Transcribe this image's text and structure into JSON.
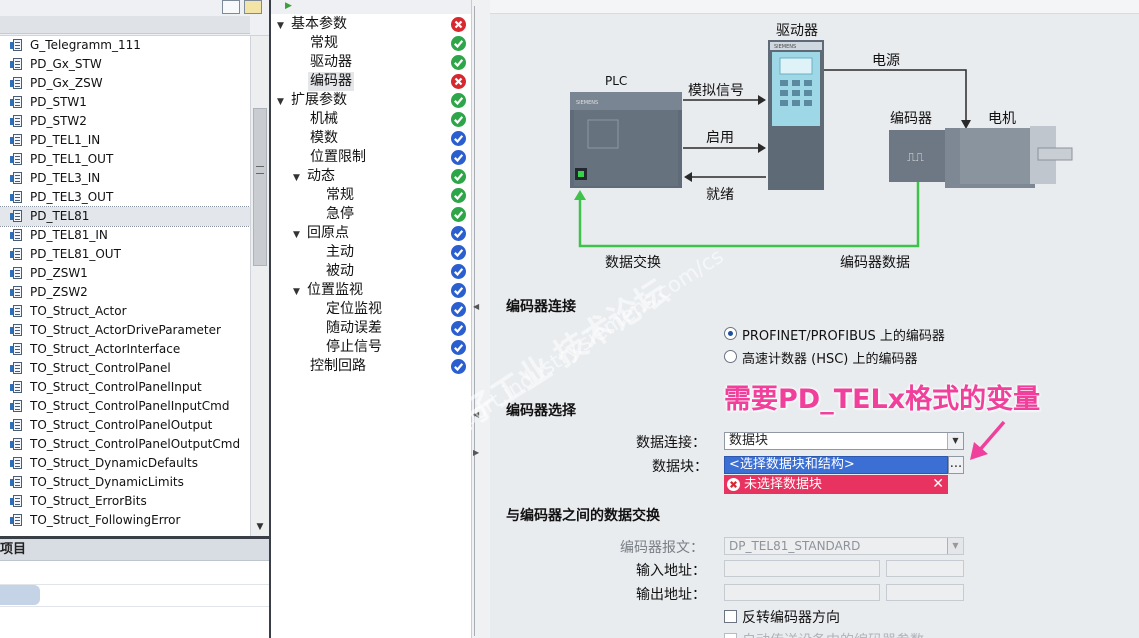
{
  "tag_list": {
    "items": [
      {
        "label": "G_Telegramm_111",
        "selected": false
      },
      {
        "label": "PD_Gx_STW",
        "selected": false
      },
      {
        "label": "PD_Gx_ZSW",
        "selected": false
      },
      {
        "label": "PD_STW1",
        "selected": false
      },
      {
        "label": "PD_STW2",
        "selected": false
      },
      {
        "label": "PD_TEL1_IN",
        "selected": false
      },
      {
        "label": "PD_TEL1_OUT",
        "selected": false
      },
      {
        "label": "PD_TEL3_IN",
        "selected": false
      },
      {
        "label": "PD_TEL3_OUT",
        "selected": false
      },
      {
        "label": "PD_TEL81",
        "selected": true
      },
      {
        "label": "PD_TEL81_IN",
        "selected": false
      },
      {
        "label": "PD_TEL81_OUT",
        "selected": false
      },
      {
        "label": "PD_ZSW1",
        "selected": false
      },
      {
        "label": "PD_ZSW2",
        "selected": false
      },
      {
        "label": "TO_Struct_Actor",
        "selected": false
      },
      {
        "label": "TO_Struct_ActorDriveParameter",
        "selected": false
      },
      {
        "label": "TO_Struct_ActorInterface",
        "selected": false
      },
      {
        "label": "TO_Struct_ControlPanel",
        "selected": false
      },
      {
        "label": "TO_Struct_ControlPanelInput",
        "selected": false
      },
      {
        "label": "TO_Struct_ControlPanelInputCmd",
        "selected": false
      },
      {
        "label": "TO_Struct_ControlPanelOutput",
        "selected": false
      },
      {
        "label": "TO_Struct_ControlPanelOutputCmd",
        "selected": false
      },
      {
        "label": "TO_Struct_DynamicDefaults",
        "selected": false
      },
      {
        "label": "TO_Struct_DynamicLimits",
        "selected": false
      },
      {
        "label": "TO_Struct_ErrorBits",
        "selected": false
      },
      {
        "label": "TO_Struct_FollowingError",
        "selected": false
      }
    ]
  },
  "details_panel": {
    "title": "项目"
  },
  "config_tree": {
    "items": [
      {
        "label": "基本参数",
        "indent": 0,
        "toggle": "▼",
        "status": "error",
        "selected": false
      },
      {
        "label": "常规",
        "indent": 1,
        "toggle": "",
        "status": "ok",
        "selected": false
      },
      {
        "label": "驱动器",
        "indent": 1,
        "toggle": "",
        "status": "ok",
        "selected": false
      },
      {
        "label": "编码器",
        "indent": 1,
        "toggle": "",
        "status": "error",
        "selected": true
      },
      {
        "label": "扩展参数",
        "indent": 0,
        "toggle": "▼",
        "status": "ok",
        "selected": false
      },
      {
        "label": "机械",
        "indent": 1,
        "toggle": "",
        "status": "ok",
        "selected": false
      },
      {
        "label": "模数",
        "indent": 1,
        "toggle": "",
        "status": "info",
        "selected": false
      },
      {
        "label": "位置限制",
        "indent": 1,
        "toggle": "",
        "status": "info",
        "selected": false
      },
      {
        "label": "动态",
        "indent": 1,
        "toggle": "▼",
        "status": "ok",
        "selected": false
      },
      {
        "label": "常规",
        "indent": 2,
        "toggle": "",
        "status": "ok",
        "selected": false
      },
      {
        "label": "急停",
        "indent": 2,
        "toggle": "",
        "status": "ok",
        "selected": false
      },
      {
        "label": "回原点",
        "indent": 1,
        "toggle": "▼",
        "status": "info",
        "selected": false
      },
      {
        "label": "主动",
        "indent": 2,
        "toggle": "",
        "status": "info",
        "selected": false
      },
      {
        "label": "被动",
        "indent": 2,
        "toggle": "",
        "status": "info",
        "selected": false
      },
      {
        "label": "位置监视",
        "indent": 1,
        "toggle": "▼",
        "status": "info",
        "selected": false
      },
      {
        "label": "定位监视",
        "indent": 2,
        "toggle": "",
        "status": "info",
        "selected": false
      },
      {
        "label": "随动误差",
        "indent": 2,
        "toggle": "",
        "status": "info",
        "selected": false
      },
      {
        "label": "停止信号",
        "indent": 2,
        "toggle": "",
        "status": "info",
        "selected": false
      },
      {
        "label": "控制回路",
        "indent": 1,
        "toggle": "",
        "status": "info",
        "selected": false
      }
    ]
  },
  "diagram": {
    "drive_label": "驱动器",
    "plc_label": "PLC",
    "power_label": "电源",
    "analog_label": "模拟信号",
    "enable_label": "启用",
    "ready_label": "就绪",
    "encoder_label": "编码器",
    "motor_label": "电机",
    "data_exchange_label": "数据交换",
    "encoder_data_label": "编码器数据",
    "siemens_mark": "SIEMENS"
  },
  "encoder_connection": {
    "title": "编码器连接",
    "options": [
      {
        "label": "PROFINET/PROFIBUS 上的编码器",
        "checked": true
      },
      {
        "label": "高速计数器 (HSC) 上的编码器",
        "checked": false
      }
    ]
  },
  "encoder_selection": {
    "title": "编码器选择",
    "data_connection_label": "数据连接：",
    "data_connection_value": "数据块",
    "data_block_label": "数据块：",
    "data_block_value": "<选择数据块和结构>",
    "browse_label": "...",
    "error_text": "未选择数据块"
  },
  "data_exchange": {
    "title": "与编码器之间的数据交换",
    "telegram_label": "编码器报文：",
    "telegram_value": "DP_TEL81_STANDARD",
    "input_label": "输入地址：",
    "output_label": "输出地址：",
    "invert_label": "反转编码器方向",
    "auto_label": "自动传送设备中的编码器参数"
  },
  "annotation": {
    "text": "需要PD_TELx格式的变量",
    "color": "#f0409b"
  },
  "watermark": {
    "line1": "西门子工业 技术论坛",
    "line2": "support.industry.siemens.com/cs"
  },
  "colors": {
    "error": "#d7282f",
    "ok": "#2fa54a",
    "info": "#2b5fcf",
    "selection": "#3b6fd4",
    "error_bar": "#e8325f",
    "link_green": "#3fc24a"
  }
}
